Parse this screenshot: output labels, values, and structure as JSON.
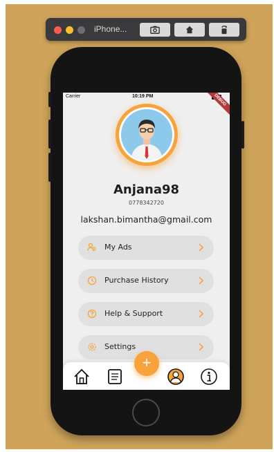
{
  "simulator": {
    "title": "iPhone...",
    "buttons": [
      "screenshot-icon",
      "home-icon",
      "rotate-icon"
    ]
  },
  "status_bar": {
    "carrier": "Carrier",
    "time": "10:19 PM",
    "debug_banner": "DEBUG"
  },
  "profile": {
    "username": "Anjana98",
    "phone": "0778342720",
    "email": "lakshan.bimantha@gmail.com"
  },
  "menu": {
    "items": [
      {
        "label": "My Ads",
        "icon": "users-icon"
      },
      {
        "label": "Purchase History",
        "icon": "history-icon"
      },
      {
        "label": "Help & Support",
        "icon": "help-icon"
      },
      {
        "label": "Settings",
        "icon": "gear-icon"
      }
    ]
  },
  "bottom_nav": {
    "items": [
      "home-icon",
      "document-icon",
      "profile-icon",
      "info-icon"
    ],
    "fab_label": "+"
  },
  "colors": {
    "accent": "#f7a23b",
    "background": "#cfa45a",
    "phone_body": "#141414",
    "screen": "#efefef"
  }
}
